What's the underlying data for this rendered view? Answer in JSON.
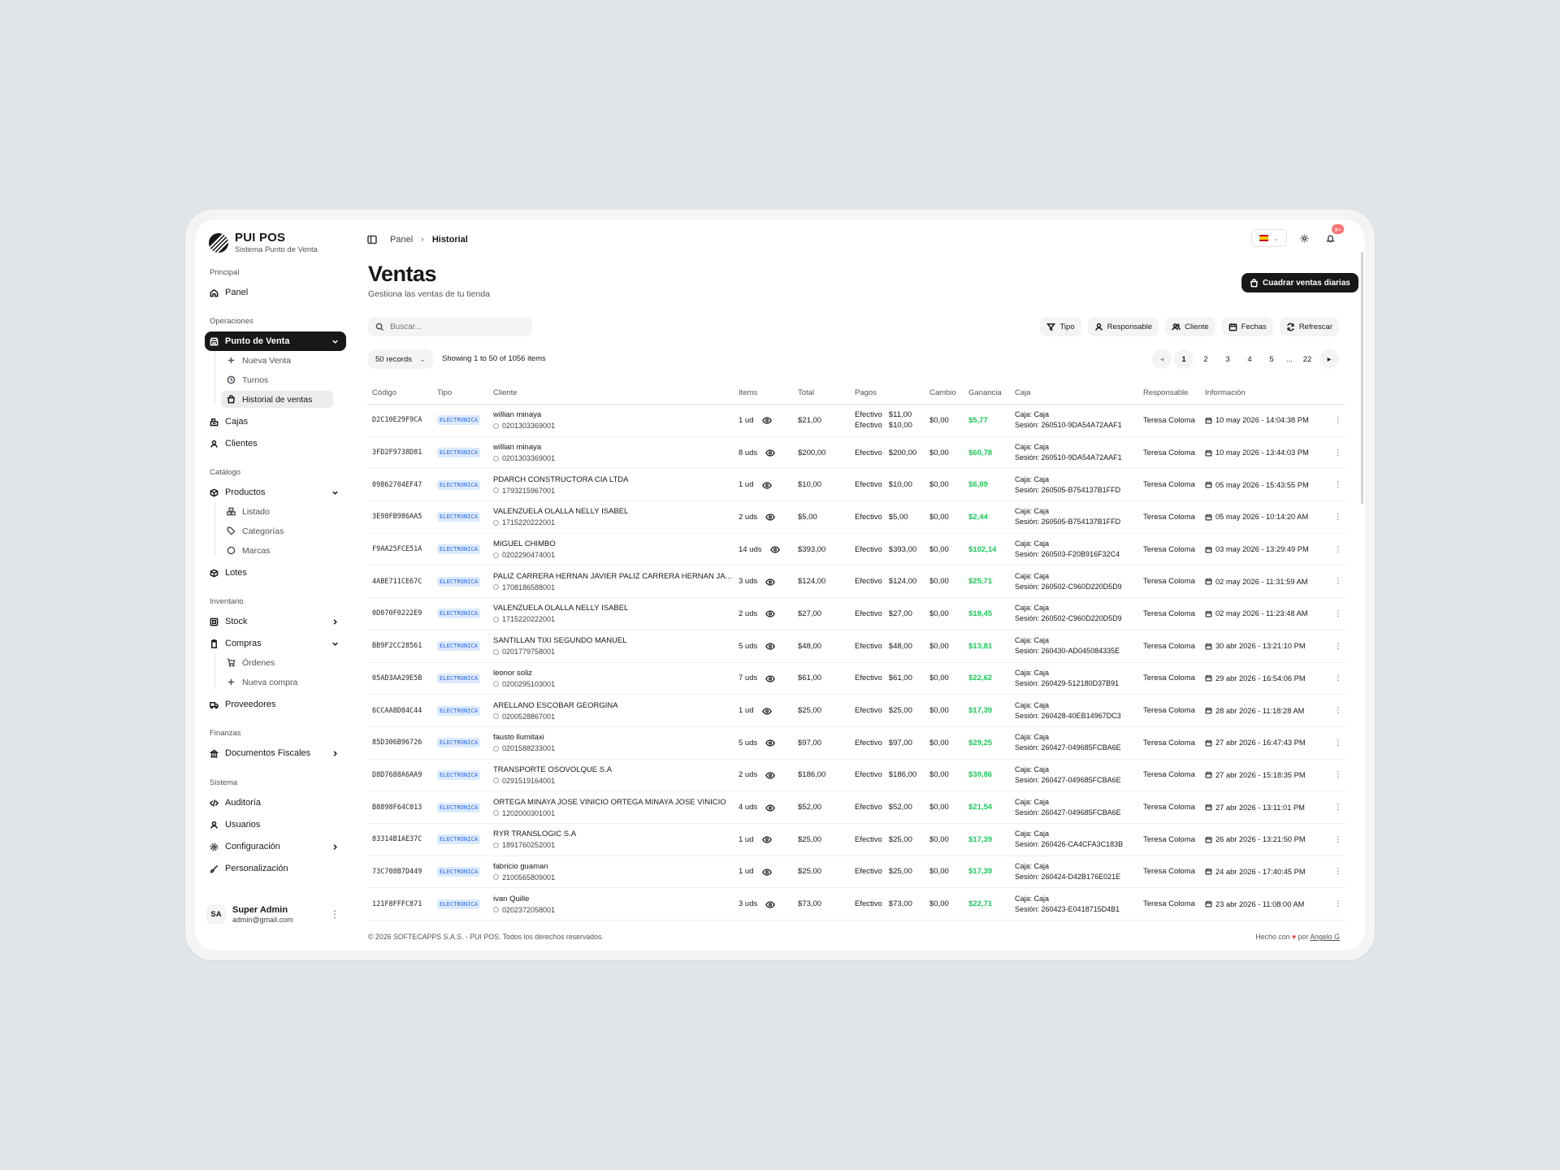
{
  "app": {
    "name": "PUI POS",
    "subtitle": "Sistema Punto de Venta"
  },
  "sidebar": {
    "sections": {
      "principal": "Principal",
      "operaciones": "Operaciones",
      "catalogo": "Catálogo",
      "inventario": "Inventario",
      "finanzas": "Finanzas",
      "sistema": "Sistema"
    },
    "items": {
      "panel": "Panel",
      "punto_venta": "Punto de Venta",
      "nueva_venta": "Nueva Venta",
      "turnos": "Turnos",
      "historial": "Historial de ventas",
      "cajas": "Cajas",
      "clientes": "Clientes",
      "productos": "Productos",
      "listado": "Listado",
      "categorias": "Categorías",
      "marcas": "Marcas",
      "lotes": "Lotes",
      "stock": "Stock",
      "compras": "Compras",
      "ordenes": "Órdenes",
      "nueva_compra": "Nueva compra",
      "proveedores": "Proveedores",
      "documentos": "Documentos Fiscales",
      "auditoria": "Auditoría",
      "usuarios": "Usuarios",
      "configuracion": "Configuración",
      "personalizacion": "Personalización"
    },
    "user": {
      "initials": "SA",
      "name": "Super Admin",
      "email": "admin@gmail.com"
    }
  },
  "header": {
    "breadcrumb": [
      "Panel",
      "Historial"
    ],
    "notifications": "9+"
  },
  "page": {
    "title": "Ventas",
    "subtitle": "Gestiona las ventas de tu tienda",
    "action_button": "Cuadrar ventas diarias",
    "search_placeholder": "Buscar...",
    "filters": [
      "Tipo",
      "Responsable",
      "Cliente",
      "Fechas",
      "Refrescar"
    ],
    "records_select": "50 records",
    "showing": "Showing 1 to 50 of 1056 items",
    "pagination": [
      "1",
      "2",
      "3",
      "4",
      "5",
      "...",
      "22"
    ]
  },
  "table": {
    "headers": [
      "Código",
      "Tipo",
      "Cliente",
      "Items",
      "Total",
      "Pagos",
      "Cambio",
      "Ganancia",
      "Caja",
      "Responsable",
      "Información"
    ],
    "rows": [
      {
        "code": "D2C10E29F9CA",
        "tipo": "ELECTRONICA",
        "cliente": "willian minaya",
        "cedula": "0201303369001",
        "items": "1 ud",
        "total": "$21,00",
        "pagos": [
          [
            "Efectivo",
            "$11,00"
          ],
          [
            "Efectivo",
            "$10,00"
          ]
        ],
        "cambio": "$0,00",
        "ganancia": "$5,77",
        "caja": "Caja: Caja",
        "sesion": "Sesión: 260510-9DA54A72AAF1",
        "resp": "Teresa Coloma",
        "info": "10 may 2026 - 14:04:38 PM"
      },
      {
        "code": "3FD2F9738D81",
        "tipo": "ELECTRONICA",
        "cliente": "willian minaya",
        "cedula": "0201303369001",
        "items": "8 uds",
        "total": "$200,00",
        "pagos": [
          [
            "Efectivo",
            "$200,00"
          ]
        ],
        "cambio": "$0,00",
        "ganancia": "$60,78",
        "caja": "Caja: Caja",
        "sesion": "Sesión: 260510-9DA54A72AAF1",
        "resp": "Teresa Coloma",
        "info": "10 may 2026 - 13:44:03 PM"
      },
      {
        "code": "09862704EF47",
        "tipo": "ELECTRONICA",
        "cliente": "PDARCH CONSTRUCTORA CIA LTDA",
        "cedula": "1793215967001",
        "items": "1 ud",
        "total": "$10,00",
        "pagos": [
          [
            "Efectivo",
            "$10,00"
          ]
        ],
        "cambio": "$0,00",
        "ganancia": "$6,09",
        "caja": "Caja: Caja",
        "sesion": "Sesión: 260505-B754137B1FFD",
        "resp": "Teresa Coloma",
        "info": "05 may 2026 - 15:43:55 PM"
      },
      {
        "code": "3E98FB986AA5",
        "tipo": "ELECTRONICA",
        "cliente": "VALENZUELA OLALLA NELLY ISABEL",
        "cedula": "1715220222001",
        "items": "2 uds",
        "total": "$5,00",
        "pagos": [
          [
            "Efectivo",
            "$5,00"
          ]
        ],
        "cambio": "$0,00",
        "ganancia": "$2,44",
        "caja": "Caja: Caja",
        "sesion": "Sesión: 260505-B754137B1FFD",
        "resp": "Teresa Coloma",
        "info": "05 may 2026 - 10:14:20 AM"
      },
      {
        "code": "F9AA25FCE51A",
        "tipo": "ELECTRONICA",
        "cliente": "MIGUEL CHIMBO",
        "cedula": "0202290474001",
        "items": "14 uds",
        "total": "$393,00",
        "pagos": [
          [
            "Efectivo",
            "$393,00"
          ]
        ],
        "cambio": "$0,00",
        "ganancia": "$102,14",
        "caja": "Caja: Caja",
        "sesion": "Sesión: 260503-F20B916F32C4",
        "resp": "Teresa Coloma",
        "info": "03 may 2026 - 13:29:49 PM"
      },
      {
        "code": "4ABE711CE67C",
        "tipo": "ELECTRONICA",
        "cliente": "PALIZ CARRERA HERNAN JAVIER PALIZ CARRERA HERNAN JAVIER",
        "cedula": "1708186588001",
        "items": "3 uds",
        "total": "$124,00",
        "pagos": [
          [
            "Efectivo",
            "$124,00"
          ]
        ],
        "cambio": "$0,00",
        "ganancia": "$25,71",
        "caja": "Caja: Caja",
        "sesion": "Sesión: 260502-C960D220D5D9",
        "resp": "Teresa Coloma",
        "info": "02 may 2026 - 11:31:59 AM"
      },
      {
        "code": "0D070F0222E9",
        "tipo": "ELECTRONICA",
        "cliente": "VALENZUELA OLALLA NELLY ISABEL",
        "cedula": "1715220222001",
        "items": "2 uds",
        "total": "$27,00",
        "pagos": [
          [
            "Efectivo",
            "$27,00"
          ]
        ],
        "cambio": "$0,00",
        "ganancia": "$18,45",
        "caja": "Caja: Caja",
        "sesion": "Sesión: 260502-C960D220D5D9",
        "resp": "Teresa Coloma",
        "info": "02 may 2026 - 11:23:48 AM"
      },
      {
        "code": "BB9F2CC28561",
        "tipo": "ELECTRONICA",
        "cliente": "SANTILLAN TIXI SEGUNDO MANUEL",
        "cedula": "0201779758001",
        "items": "5 uds",
        "total": "$48,00",
        "pagos": [
          [
            "Efectivo",
            "$48,00"
          ]
        ],
        "cambio": "$0,00",
        "ganancia": "$13,81",
        "caja": "Caja: Caja",
        "sesion": "Sesión: 260430-AD045084335E",
        "resp": "Teresa Coloma",
        "info": "30 abr 2026 - 13:21:10 PM"
      },
      {
        "code": "05AD3AA29E5B",
        "tipo": "ELECTRONICA",
        "cliente": "leonor soliz",
        "cedula": "0200295103001",
        "items": "7 uds",
        "total": "$61,00",
        "pagos": [
          [
            "Efectivo",
            "$61,00"
          ]
        ],
        "cambio": "$0,00",
        "ganancia": "$22,62",
        "caja": "Caja: Caja",
        "sesion": "Sesión: 260429-512180D37B91",
        "resp": "Teresa Coloma",
        "info": "29 abr 2026 - 16:54:06 PM"
      },
      {
        "code": "6CCAA8D84C44",
        "tipo": "ELECTRONICA",
        "cliente": "ARELLANO ESCOBAR GEORGINA",
        "cedula": "0200528867001",
        "items": "1 ud",
        "total": "$25,00",
        "pagos": [
          [
            "Efectivo",
            "$25,00"
          ]
        ],
        "cambio": "$0,00",
        "ganancia": "$17,39",
        "caja": "Caja: Caja",
        "sesion": "Sesión: 260428-40EB14967DC3",
        "resp": "Teresa Coloma",
        "info": "28 abr 2026 - 11:18:28 AM"
      },
      {
        "code": "85D306B96726",
        "tipo": "ELECTRONICA",
        "cliente": "fausto llumitaxi",
        "cedula": "0201588233001",
        "items": "5 uds",
        "total": "$97,00",
        "pagos": [
          [
            "Efectivo",
            "$97,00"
          ]
        ],
        "cambio": "$0,00",
        "ganancia": "$29,25",
        "caja": "Caja: Caja",
        "sesion": "Sesión: 260427-049685FCBA6E",
        "resp": "Teresa Coloma",
        "info": "27 abr 2026 - 16:47:43 PM"
      },
      {
        "code": "D8D7688A6AA9",
        "tipo": "ELECTRONICA",
        "cliente": "TRANSPORTE OSOVOLQUE S.A",
        "cedula": "0291519164001",
        "items": "2 uds",
        "total": "$186,00",
        "pagos": [
          [
            "Efectivo",
            "$186,00"
          ]
        ],
        "cambio": "$0,00",
        "ganancia": "$30,86",
        "caja": "Caja: Caja",
        "sesion": "Sesión: 260427-049685FCBA6E",
        "resp": "Teresa Coloma",
        "info": "27 abr 2026 - 15:18:35 PM"
      },
      {
        "code": "B8898F64C013",
        "tipo": "ELECTRONICA",
        "cliente": "ORTEGA MINAYA JOSE VINICIO ORTEGA MINAYA JOSE VINICIO",
        "cedula": "1202000301001",
        "items": "4 uds",
        "total": "$52,00",
        "pagos": [
          [
            "Efectivo",
            "$52,00"
          ]
        ],
        "cambio": "$0,00",
        "ganancia": "$21,54",
        "caja": "Caja: Caja",
        "sesion": "Sesión: 260427-049685FCBA6E",
        "resp": "Teresa Coloma",
        "info": "27 abr 2026 - 13:11:01 PM"
      },
      {
        "code": "83314B1AE37C",
        "tipo": "ELECTRONICA",
        "cliente": "RYR TRANSLOGIC S.A",
        "cedula": "1891760252001",
        "items": "1 ud",
        "total": "$25,00",
        "pagos": [
          [
            "Efectivo",
            "$25,00"
          ]
        ],
        "cambio": "$0,00",
        "ganancia": "$17,39",
        "caja": "Caja: Caja",
        "sesion": "Sesión: 260426-CA4CFA3C183B",
        "resp": "Teresa Coloma",
        "info": "26 abr 2026 - 13:21:50 PM"
      },
      {
        "code": "73C708B7D449",
        "tipo": "ELECTRONICA",
        "cliente": "fabricio guaman",
        "cedula": "2100565809001",
        "items": "1 ud",
        "total": "$25,00",
        "pagos": [
          [
            "Efectivo",
            "$25,00"
          ]
        ],
        "cambio": "$0,00",
        "ganancia": "$17,39",
        "caja": "Caja: Caja",
        "sesion": "Sesión: 260424-D42B176E021E",
        "resp": "Teresa Coloma",
        "info": "24 abr 2026 - 17:40:45 PM"
      },
      {
        "code": "121F8FFFC871",
        "tipo": "ELECTRONICA",
        "cliente": "ivan Quille",
        "cedula": "0202372058001",
        "items": "3 uds",
        "total": "$73,00",
        "pagos": [
          [
            "Efectivo",
            "$73,00"
          ]
        ],
        "cambio": "$0,00",
        "ganancia": "$22,71",
        "caja": "Caja: Caja",
        "sesion": "Sesión: 260423-E0418715D4B1",
        "resp": "Teresa Coloma",
        "info": "23 abr 2026 - 11:08:00 AM"
      }
    ]
  },
  "footer": {
    "copyright": "© 2026 SOFTECAPPS S.A.S. - PUI POS. Todos los derechos reservados.",
    "made_with": "Hecho con",
    "by": "por",
    "author": "Angelo G"
  },
  "colors": {
    "accent": "#18181b",
    "profit": "#22c55e",
    "badge_bg": "#dbeafe",
    "badge_text": "#2563eb",
    "notify": "#f87171"
  }
}
